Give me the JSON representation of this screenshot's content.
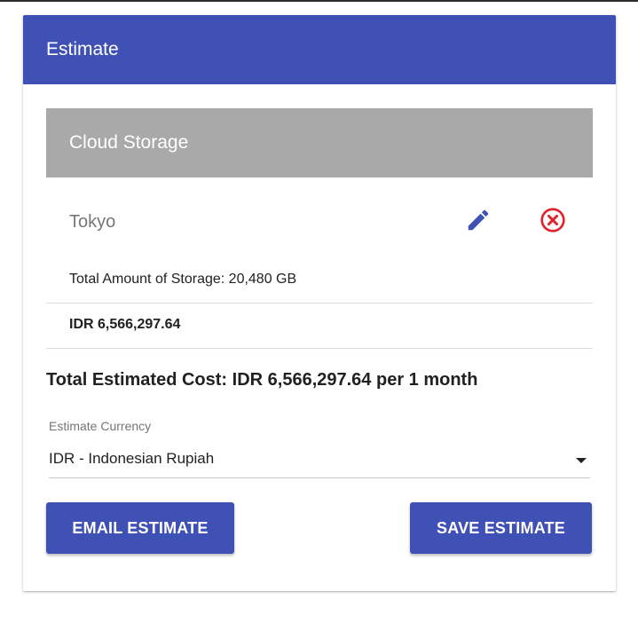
{
  "card": {
    "title": "Estimate"
  },
  "service": {
    "name": "Cloud Storage",
    "region": "Tokyo",
    "detail": "Total Amount of Storage: 20,480 GB",
    "cost": "IDR 6,566,297.64",
    "edit_icon": "pencil-icon",
    "remove_icon": "close-circle-icon"
  },
  "total": {
    "text": "Total Estimated Cost: IDR 6,566,297.64 per 1 month"
  },
  "currency": {
    "label": "Estimate Currency",
    "selected": "IDR - Indonesian Rupiah"
  },
  "actions": {
    "email_label": "EMAIL ESTIMATE",
    "save_label": "SAVE ESTIMATE"
  },
  "colors": {
    "primary": "#3f51b5",
    "service_bar": "#a9a9a9",
    "danger": "#e0232f"
  }
}
